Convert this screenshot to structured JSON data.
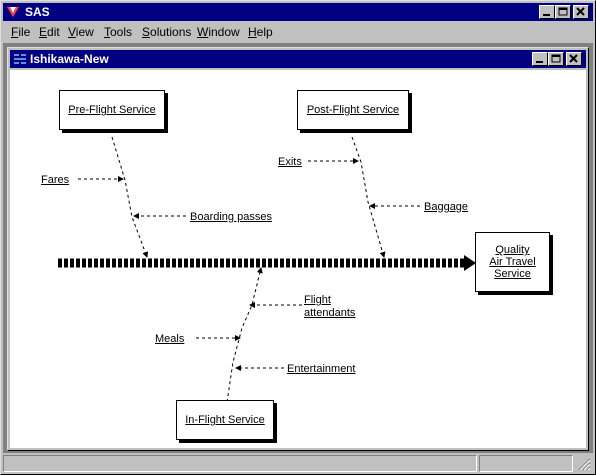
{
  "app": {
    "title": "SAS"
  },
  "menu": [
    {
      "pre": "",
      "u": "F",
      "post": "ile"
    },
    {
      "pre": "",
      "u": "E",
      "post": "dit"
    },
    {
      "pre": "",
      "u": "V",
      "post": "iew"
    },
    {
      "pre": "",
      "u": "T",
      "post": "ools"
    },
    {
      "pre": "",
      "u": "S",
      "post": "olutions"
    },
    {
      "pre": "",
      "u": "W",
      "post": "indow"
    },
    {
      "pre": "",
      "u": "H",
      "post": "elp"
    }
  ],
  "child_window": {
    "title": "Ishikawa-New"
  },
  "diagram": {
    "effect": [
      "Quality",
      "Air Travel",
      "Service"
    ],
    "causes": {
      "pre_flight": "Pre-Flight Service",
      "post_flight": "Post-Flight Service",
      "in_flight": "In-Flight Service"
    },
    "subcauses": {
      "fares": "Fares",
      "boarding_passes": "Boarding passes",
      "exits": "Exits",
      "baggage": "Baggage",
      "flight_attendants": [
        "Flight",
        "attendants"
      ],
      "meals": "Meals",
      "entertainment": "Entertainment"
    }
  },
  "colors": {
    "title_bar": "#000080",
    "face": "#c0c0c0",
    "canvas": "#ffffff"
  }
}
